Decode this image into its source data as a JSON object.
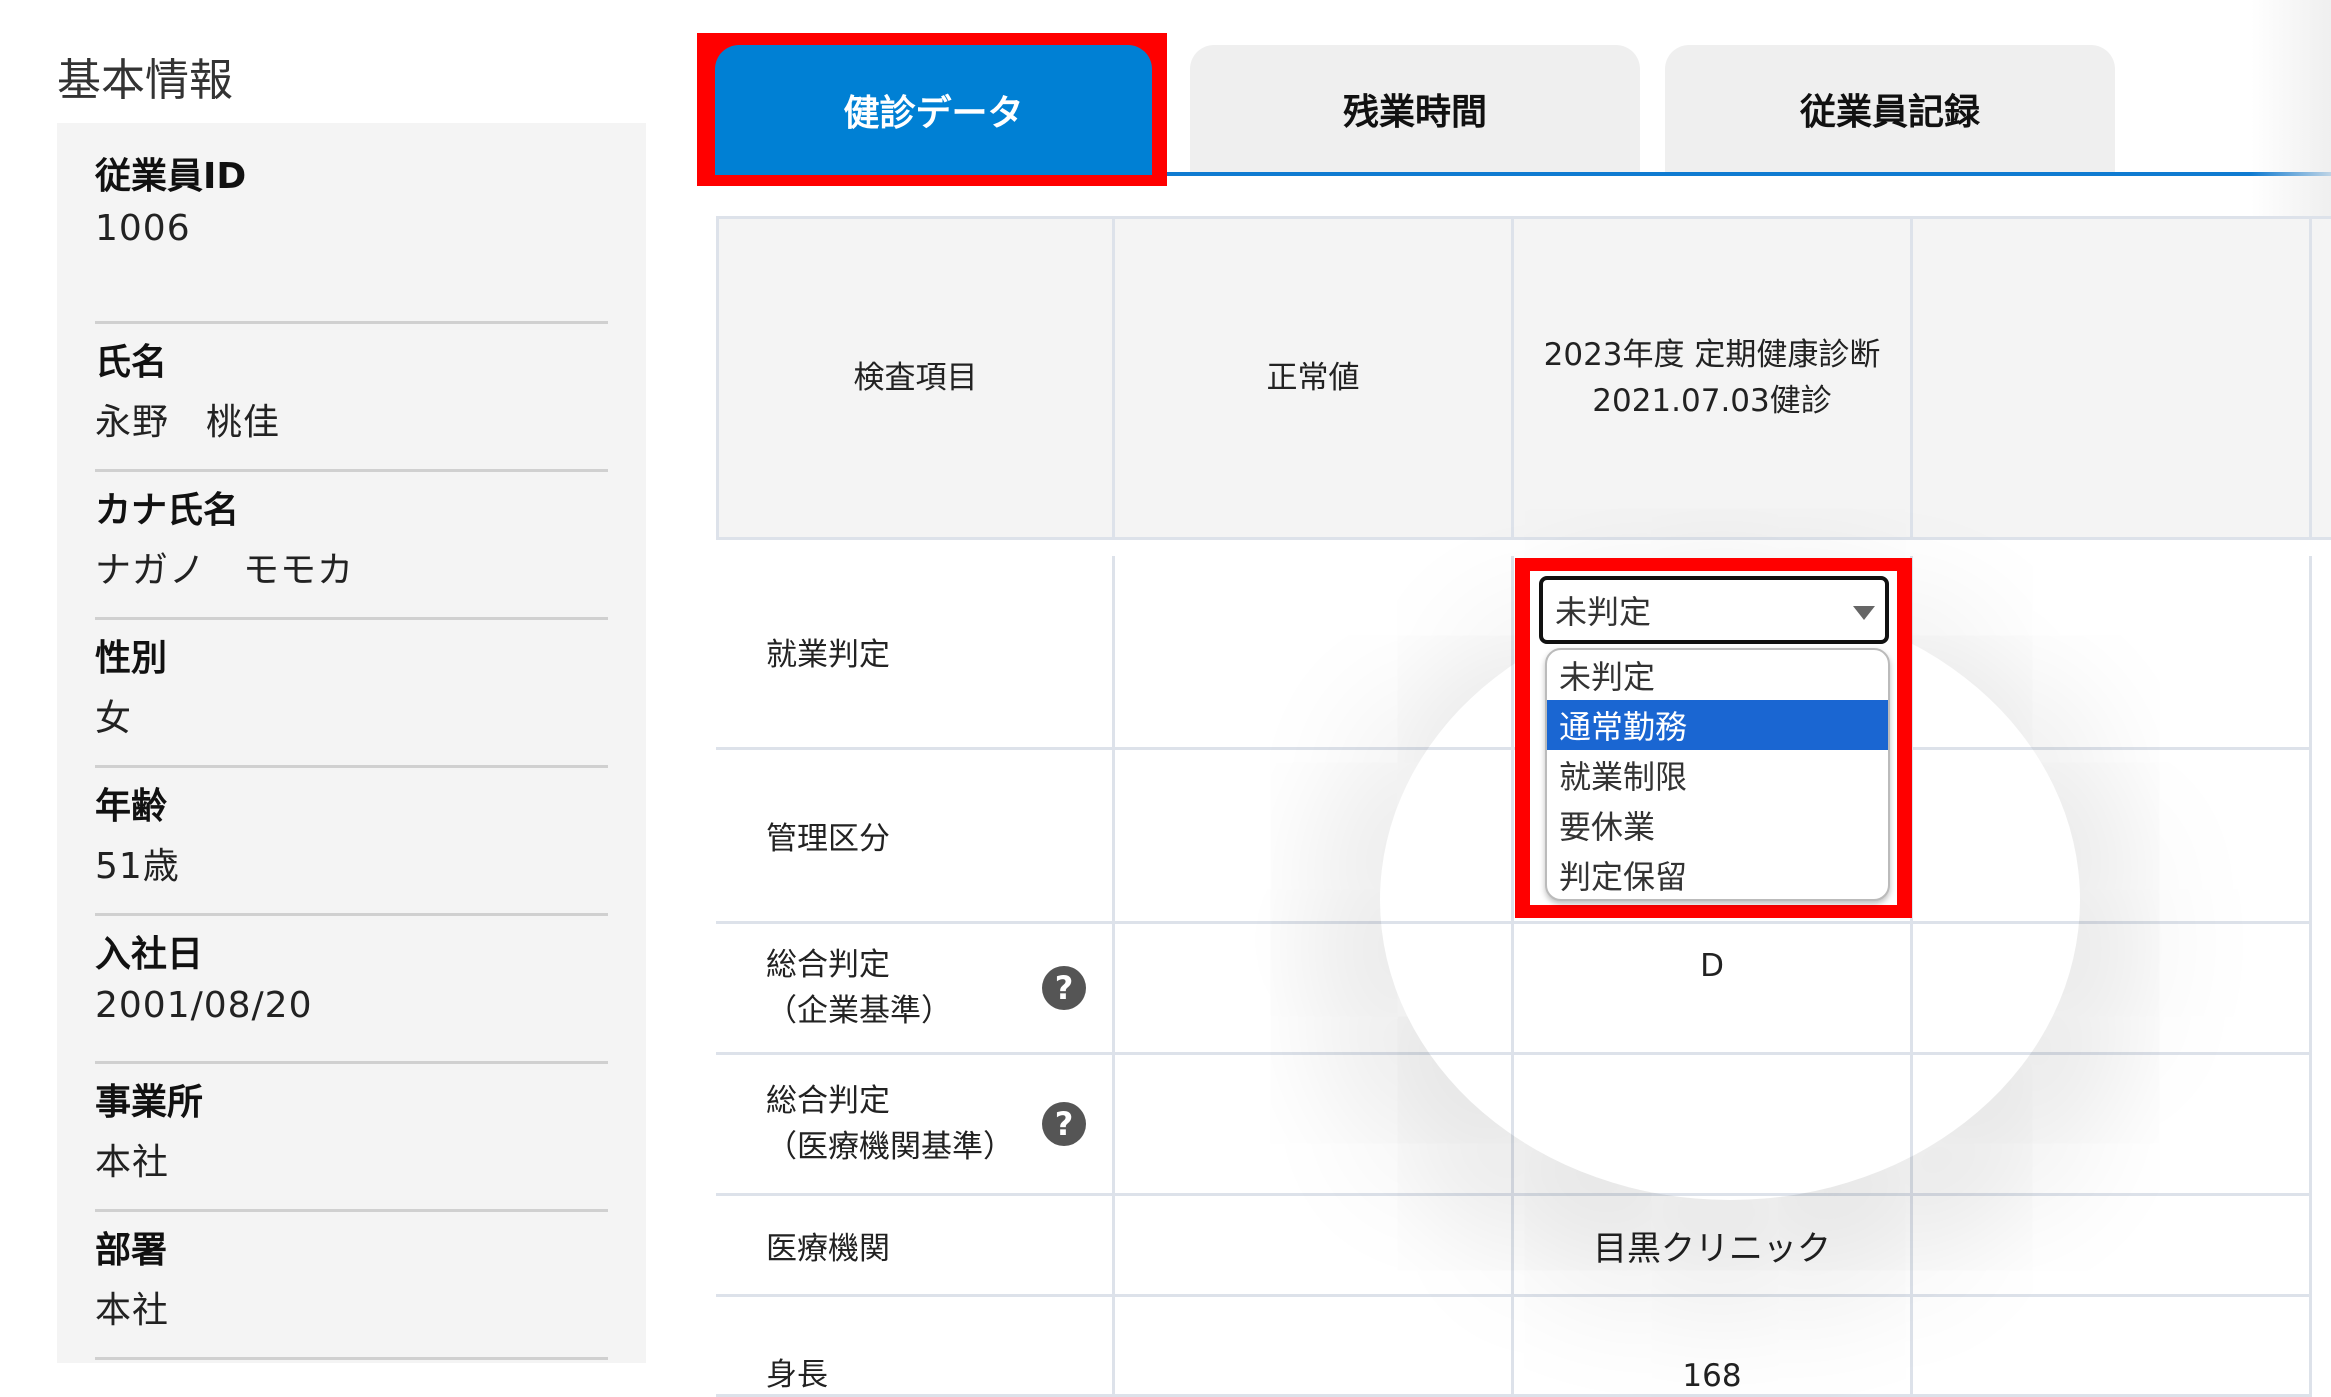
{
  "sidebar": {
    "title": "基本情報",
    "items": [
      {
        "label": "従業員ID",
        "value": "1006"
      },
      {
        "label": "氏名",
        "value": "永野　桃佳"
      },
      {
        "label": "カナ氏名",
        "value": "ナガノ　モモカ"
      },
      {
        "label": "性別",
        "value": "女"
      },
      {
        "label": "年齢",
        "value": "51歳"
      },
      {
        "label": "入社日",
        "value": "2001/08/20"
      },
      {
        "label": "事業所",
        "value": "本社"
      },
      {
        "label": "部署",
        "value": "本社"
      }
    ]
  },
  "tabs": [
    {
      "label": "健診データ",
      "active": true
    },
    {
      "label": "残業時間",
      "active": false
    },
    {
      "label": "従業員記録",
      "active": false
    }
  ],
  "table": {
    "headers": [
      "検査項目",
      "正常値",
      "2023年度 定期健康診断",
      "2021.07.03健診",
      ""
    ],
    "rows": [
      {
        "item": "就業判定",
        "normal": "",
        "value": ""
      },
      {
        "item": "管理区分",
        "normal": "",
        "value": ""
      },
      {
        "item_line1": "総合判定",
        "item_line2": "（企業基準）",
        "normal": "",
        "value": "D",
        "help_icon": "question-circle-icon"
      },
      {
        "item_line1": "総合判定",
        "item_line2": "（医療機関基準）",
        "normal": "",
        "value": "",
        "help_icon": "question-circle-icon"
      },
      {
        "item": "医療機関",
        "normal": "",
        "value": "目黒クリニック"
      },
      {
        "item": "身長",
        "normal": "",
        "value": "168"
      }
    ]
  },
  "dropdown": {
    "selected_value": "未判定",
    "options": [
      "未判定",
      "通常勤務",
      "就業制限",
      "要休業",
      "判定保留"
    ],
    "highlighted_option": "通常勤務"
  },
  "colors": {
    "active_tab": "#0080d4",
    "highlight_box": "#ff0000",
    "option_highlight": "#1a66d2",
    "inactive_tab": "#efefef"
  }
}
